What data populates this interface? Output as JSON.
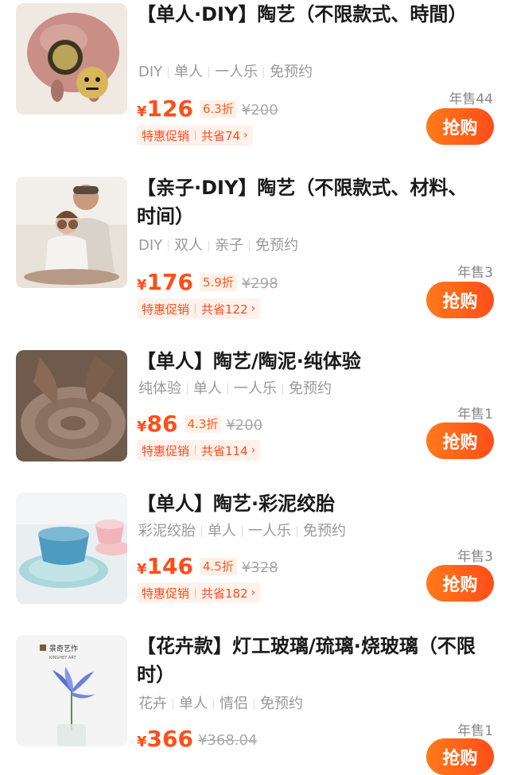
{
  "items": [
    {
      "title": "【单人·DIY】陶艺（不限款式、時間）",
      "tags": [
        "DIY",
        "单人",
        "一人乐",
        "免预约"
      ],
      "yen": "¥",
      "price": "126",
      "discount": "6.3折",
      "orig_price": "¥200",
      "promo_label": "特惠促销",
      "promo_save": "共省74",
      "sales": "年售44",
      "buy_label": "抢购",
      "thumb_desc": "piggy-bank"
    },
    {
      "title": "【亲子·DIY】陶艺（不限款式、材料、时间）",
      "tags": [
        "DIY",
        "双人",
        "亲子",
        "免预约"
      ],
      "yen": "¥",
      "price": "176",
      "discount": "5.9折",
      "orig_price": "¥298",
      "promo_label": "特惠促销",
      "promo_save": "共省122",
      "sales": "年售3",
      "buy_label": "抢购",
      "thumb_desc": "parent-child"
    },
    {
      "title": "【单人】陶艺/陶泥·纯体验",
      "tags": [
        "纯体验",
        "单人",
        "一人乐",
        "免预约"
      ],
      "yen": "¥",
      "price": "86",
      "discount": "4.3折",
      "orig_price": "¥200",
      "promo_label": "特惠促销",
      "promo_save": "共省114",
      "sales": "年售1",
      "buy_label": "抢购",
      "thumb_desc": "pottery-wheel"
    },
    {
      "title": "【单人】陶艺·彩泥绞胎",
      "tags": [
        "彩泥绞胎",
        "单人",
        "一人乐",
        "免预约"
      ],
      "yen": "¥",
      "price": "146",
      "discount": "4.5折",
      "orig_price": "¥328",
      "promo_label": "特惠促销",
      "promo_save": "共省182",
      "sales": "年售3",
      "buy_label": "抢购",
      "thumb_desc": "blue-bowls"
    },
    {
      "title": "【花卉款】灯工玻璃/琉璃·烧玻璃（不限时）",
      "tags": [
        "花卉",
        "单人",
        "情侣",
        "免预约"
      ],
      "yen": "¥",
      "price": "366",
      "orig_price": "¥368.04",
      "sales": "年售1",
      "buy_label": "抢购",
      "thumb_desc": "glass-flower",
      "brand_text": "景奇艺作",
      "brand_sub": "KINGHEY ART"
    }
  ],
  "colors": {
    "accent": "#ff4d1a",
    "accent_start": "#ff7a1a"
  },
  "icons": {
    "chevron": "chevron-right-icon"
  }
}
